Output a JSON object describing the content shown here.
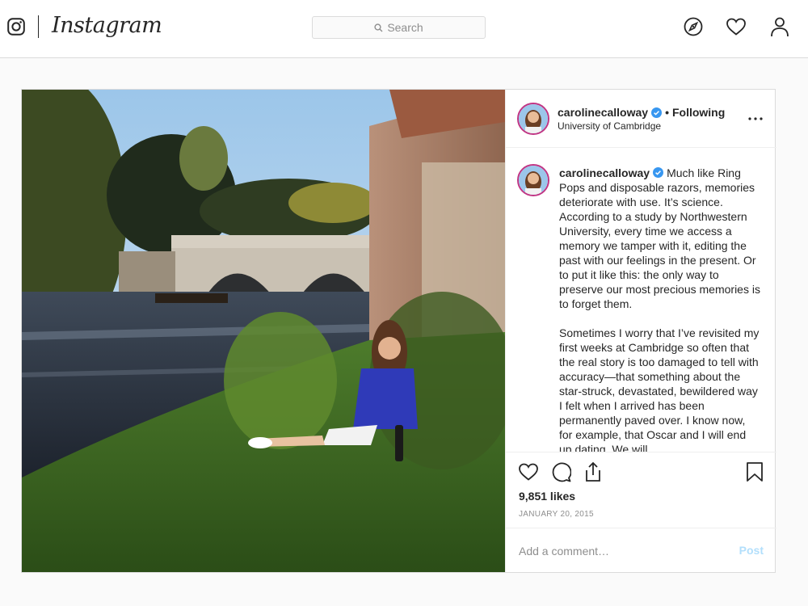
{
  "app": {
    "name": "Instagram"
  },
  "search": {
    "placeholder": "Search"
  },
  "nav": {
    "icons": [
      "explore-icon",
      "heart-icon",
      "profile-icon"
    ]
  },
  "post": {
    "username": "carolinecalloway",
    "verified": true,
    "follow_status": "Following",
    "separator": "•",
    "location": "University of Cambridge",
    "caption_text": "Much like Ring Pops and disposable razors, memories deteriorate with use. It’s science. According to a study by Northwestern University, every time we access a memory we tamper with it, editing the past with our feelings in the present. Or to put it like this: the only way to preserve our most precious memories is to forget them.\n\nSometimes I worry that I’ve revisited my first weeks at Cambridge so often that the real story is too damaged to tell with accuracy—that something about the star-struck, devastated, bewildered way I felt when I arrived has been permanently paved over. I know now, for example, that Oscar and I will end up dating. We will",
    "likes": "9,851 likes",
    "date": "JANUARY 20, 2015",
    "comment_placeholder": "Add a comment…",
    "post_button": "Post"
  },
  "colors": {
    "border": "#dbdbdb",
    "verified": "#3897f0",
    "post_disabled": "#b2dffc",
    "muted": "#8e8e8e"
  }
}
